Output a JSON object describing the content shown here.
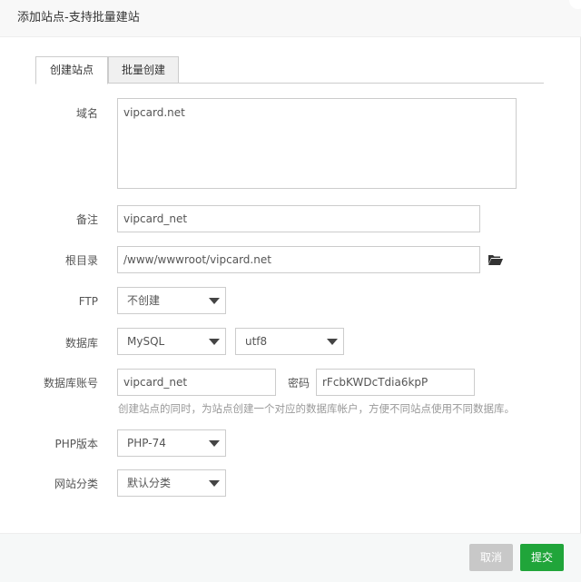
{
  "dialog": {
    "title": "添加站点-支持批量建站"
  },
  "tabs": [
    {
      "label": "创建站点",
      "active": true
    },
    {
      "label": "批量创建",
      "active": false
    }
  ],
  "form": {
    "domain": {
      "label": "域名",
      "value": "vipcard.net"
    },
    "remark": {
      "label": "备注",
      "value": "vipcard_net"
    },
    "root": {
      "label": "根目录",
      "value": "/www/wwwroot/vipcard.net",
      "icon": "folder-open-icon"
    },
    "ftp": {
      "label": "FTP",
      "value": "不创建"
    },
    "database": {
      "label": "数据库",
      "type_value": "MySQL",
      "charset_value": "utf8"
    },
    "db_account": {
      "label": "数据库账号",
      "value": "vipcard_net",
      "password_label": "密码",
      "password_value": "rFcbKWDcTdia6kpP"
    },
    "hint": "创建站点的同时，为站点创建一个对应的数据库帐户，方便不同站点使用不同数据库。",
    "php": {
      "label": "PHP版本",
      "value": "PHP-74"
    },
    "category": {
      "label": "网站分类",
      "value": "默认分类"
    }
  },
  "footer": {
    "cancel_label": "取消",
    "submit_label": "提交"
  },
  "colors": {
    "submit": "#20a53a",
    "cancel": "#c8c8c8",
    "border": "#cccccc"
  }
}
